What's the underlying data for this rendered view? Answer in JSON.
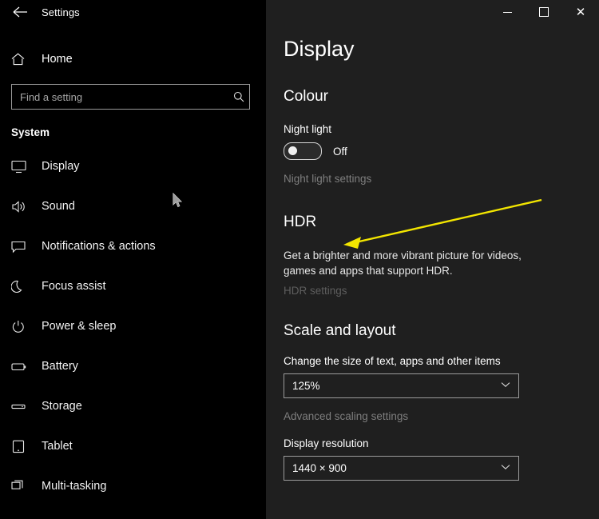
{
  "titlebar": {
    "back_icon": "back-arrow-icon",
    "app_title": "Settings",
    "minimize_label": "minimize",
    "maximize_label": "maximize",
    "close_label": "✕"
  },
  "sidebar": {
    "home_label": "Home",
    "search": {
      "placeholder": "Find a setting",
      "value": "",
      "icon": "search-icon"
    },
    "section_label": "System",
    "items": [
      {
        "label": "Display",
        "icon": "monitor-icon"
      },
      {
        "label": "Sound",
        "icon": "speaker-icon"
      },
      {
        "label": "Notifications & actions",
        "icon": "chat-bubble-icon"
      },
      {
        "label": "Focus assist",
        "icon": "moon-icon"
      },
      {
        "label": "Power & sleep",
        "icon": "power-icon"
      },
      {
        "label": "Battery",
        "icon": "battery-icon"
      },
      {
        "label": "Storage",
        "icon": "storage-icon"
      },
      {
        "label": "Tablet",
        "icon": "tablet-icon"
      },
      {
        "label": "Multi-tasking",
        "icon": "multitasking-icon"
      }
    ]
  },
  "main": {
    "page_title": "Display",
    "colour": {
      "heading": "Colour",
      "night_light_label": "Night light",
      "night_light_state": "Off",
      "night_light_settings_link": "Night light settings"
    },
    "hdr": {
      "heading": "HDR",
      "description": "Get a brighter and more vibrant picture for videos, games and apps that support HDR.",
      "settings_link": "HDR settings"
    },
    "scale": {
      "heading": "Scale and layout",
      "size_label": "Change the size of text, apps and other items",
      "size_value": "125%",
      "advanced_link": "Advanced scaling settings",
      "resolution_label": "Display resolution",
      "resolution_value": "1440 × 900"
    }
  },
  "annotation": {
    "arrow_colour": "#f2e500",
    "arrow_name": "yellow-pointer-arrow"
  }
}
